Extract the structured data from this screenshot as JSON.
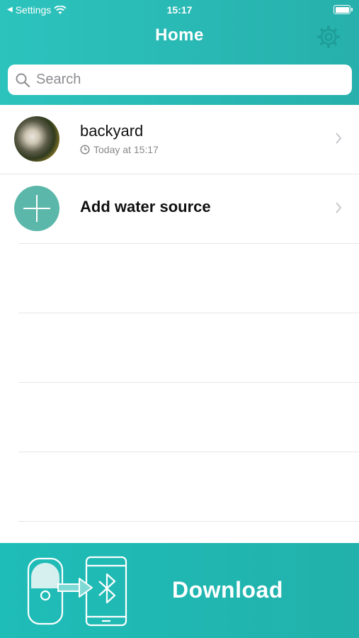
{
  "status_bar": {
    "back_app": "Settings",
    "time": "15:17"
  },
  "nav": {
    "title": "Home"
  },
  "search": {
    "placeholder": "Search"
  },
  "list": {
    "items": [
      {
        "title": "backyard",
        "subtitle": "Today at 15:17"
      },
      {
        "title": "Add water source"
      }
    ]
  },
  "download": {
    "label": "Download"
  },
  "icons": {
    "settings": "gear-icon",
    "search": "magnifier-icon",
    "clock": "clock-icon",
    "chevron": "chevron-right-icon",
    "add": "plus-icon",
    "bluetooth": "bluetooth-icon"
  },
  "colors": {
    "header": "#2cc3bd",
    "download_bar": "#1fbdb8",
    "add_circle": "#5bb7a9",
    "gear": "#1f9f9a"
  }
}
